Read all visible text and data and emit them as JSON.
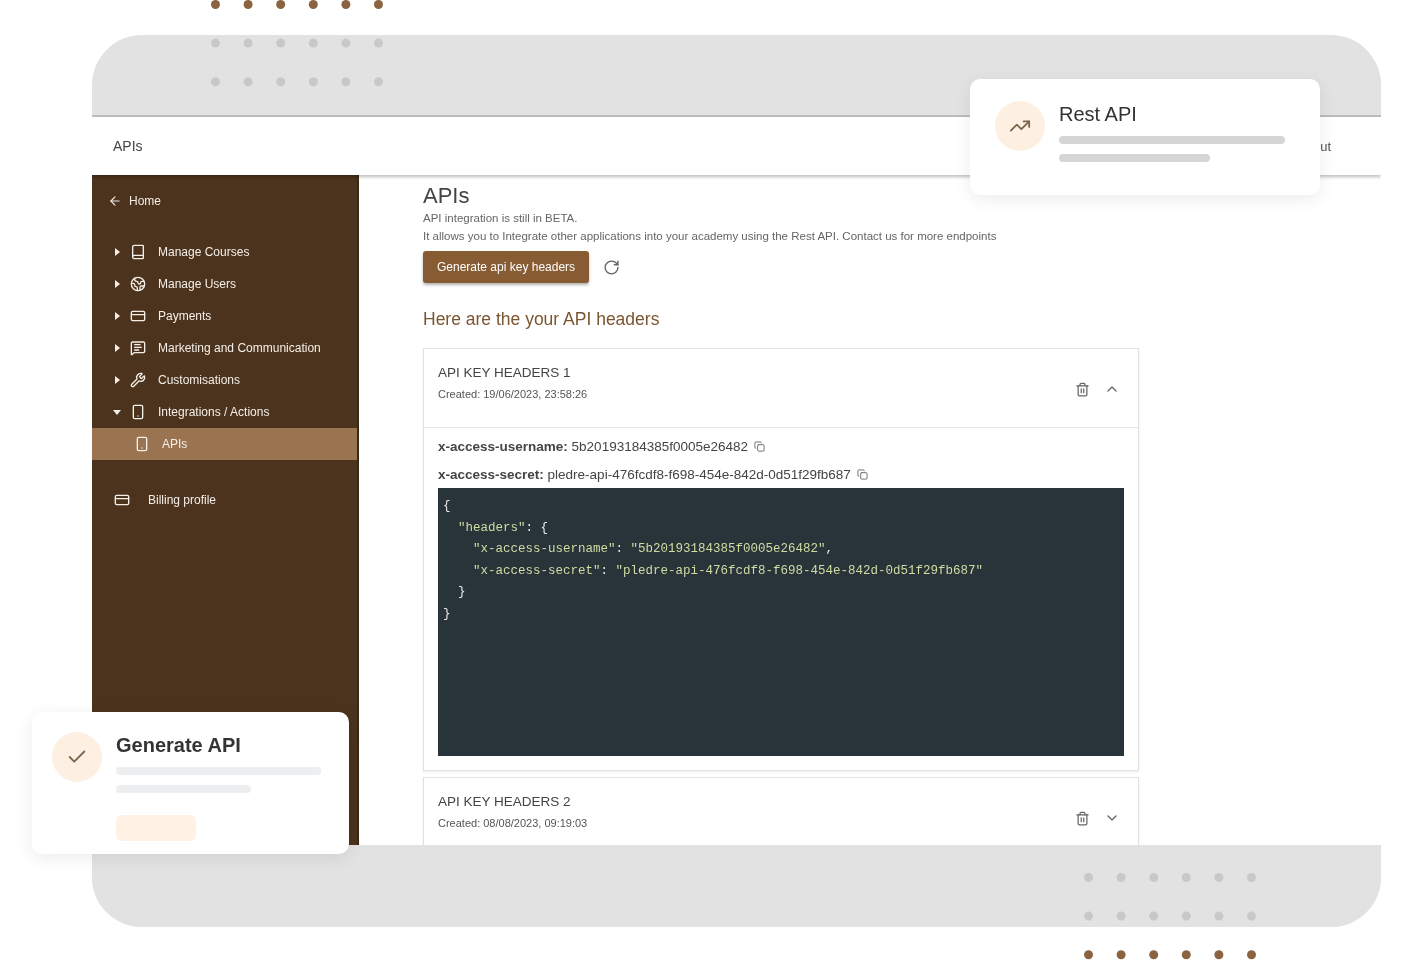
{
  "header": {
    "title": "APIs",
    "right_text": "ut"
  },
  "sidebar": {
    "back_link": "Home",
    "items": [
      {
        "label": "Manage Courses",
        "expanded": false
      },
      {
        "label": "Manage Users",
        "expanded": false
      },
      {
        "label": "Payments",
        "expanded": false
      },
      {
        "label": "Marketing and Communication",
        "expanded": false
      },
      {
        "label": "Customisations",
        "expanded": false
      },
      {
        "label": "Integrations / Actions",
        "expanded": true,
        "children": [
          {
            "label": "APIs",
            "selected": true
          }
        ]
      }
    ],
    "bottom_items": [
      {
        "label": "Billing profile"
      }
    ]
  },
  "page": {
    "title": "APIs",
    "notes": [
      "API integration is still in BETA.",
      "It allows you to Integrate other applications into your academy using the Rest API. Contact us for more endpoints"
    ],
    "generate_button": "Generate api key headers",
    "section_title": "Here are the your API headers"
  },
  "api_keys": [
    {
      "title": "API KEY HEADERS 1",
      "created": "Created: 19/06/2023, 23:58:26",
      "expanded": true,
      "fields": [
        {
          "label": "x-access-username:",
          "value": "5b20193184385f0005e26482"
        },
        {
          "label": "x-access-secret:",
          "value": "pledre-api-476fcdf8-f698-454e-842d-0d51f29fb687"
        }
      ],
      "code_lines": [
        "{",
        "  \"headers\": {",
        "    \"x-access-username\": \"5b20193184385f0005e26482\",",
        "    \"x-access-secret\": \"pledre-api-476fcdf8-f698-454e-842d-0d51f29fb687\"",
        "  }",
        "}"
      ]
    },
    {
      "title": "API KEY HEADERS 2",
      "created": "Created: 08/08/2023, 09:19:03",
      "expanded": false
    }
  ],
  "cards": [
    {
      "kind": "trend",
      "title": "Rest API"
    },
    {
      "kind": "check",
      "title": "Generate API"
    }
  ]
}
